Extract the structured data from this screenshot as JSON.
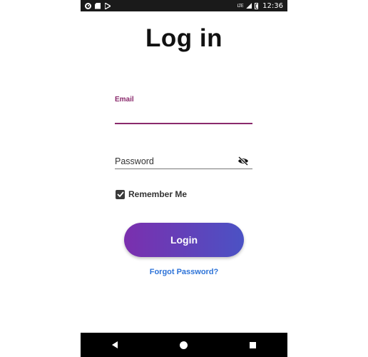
{
  "status_bar": {
    "time": "12:36",
    "network": "LTE",
    "left_icons": [
      "app-circle-icon",
      "sd-card-icon",
      "play-store-icon"
    ],
    "right_icons": [
      "lte-signal-icon",
      "battery-icon"
    ]
  },
  "title": "Log in",
  "email": {
    "label": "Email",
    "value": "",
    "accent_color": "#8a2a6c"
  },
  "password": {
    "placeholder": "Password",
    "value": "",
    "toggle_icon": "eye-off-icon"
  },
  "remember": {
    "label": "Remember Me",
    "checked": true
  },
  "login_button": {
    "label": "Login",
    "gradient_start": "#7b2fae",
    "gradient_end": "#4b52c4"
  },
  "forgot_password": {
    "label": "Forgot Password?",
    "color": "#2d73d8"
  },
  "nav_bar": {
    "buttons": [
      "back-icon",
      "home-icon",
      "recents-icon"
    ]
  }
}
